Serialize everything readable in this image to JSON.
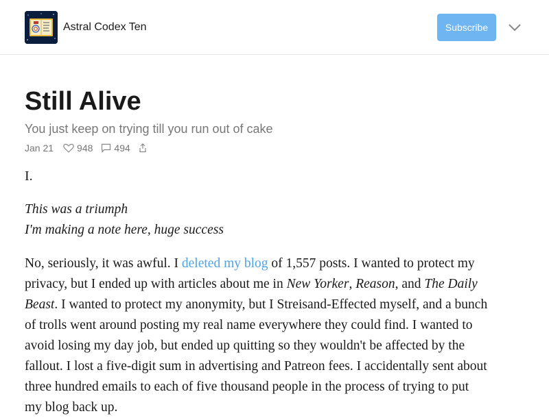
{
  "header": {
    "publication_name": "Astral Codex Ten",
    "subscribe_label": "Subscribe",
    "accent_color": "#6eb5f2",
    "logo_icon": "astral-codex-ten-logo",
    "menu_icon": "chevron-down-icon"
  },
  "post": {
    "title": "Still Alive",
    "subtitle": "You just keep on trying till you run out of cake",
    "date": "Jan 21",
    "likes": "948",
    "comments": "494",
    "section_heading": "I.",
    "poem_lines": [
      "This was a triumph",
      "I'm making a note here, huge success"
    ],
    "paragraph": {
      "line1_pre": "No, seriously, it was awful. I ",
      "link_text": "deleted my blog",
      "line1_post": " of 1,557 posts. I wanted to protect my",
      "line2_pre": "privacy, but I ended up with articles about me in ",
      "pub1": "New Yorker",
      "sep1": ", ",
      "pub2": "Reason",
      "sep2": ", and ",
      "pub3a": "The Daily",
      "pub3b": "Beast",
      "line3_post": ". I wanted to protect my anonymity, but I Streisand-Effected myself, and a bunch",
      "line4": "of trolls went around posting my real name everywhere they could find. I wanted to",
      "line5": "avoid losing my day job, but ended up quitting so they wouldn't be affected by the",
      "line6": "fallout. I lost a five-digit sum in advertising and Patreon fees. I accidentally sent about",
      "line7": "three hundred emails to each of five thousand people in the process of trying to put",
      "line8": "my blog back up."
    }
  }
}
